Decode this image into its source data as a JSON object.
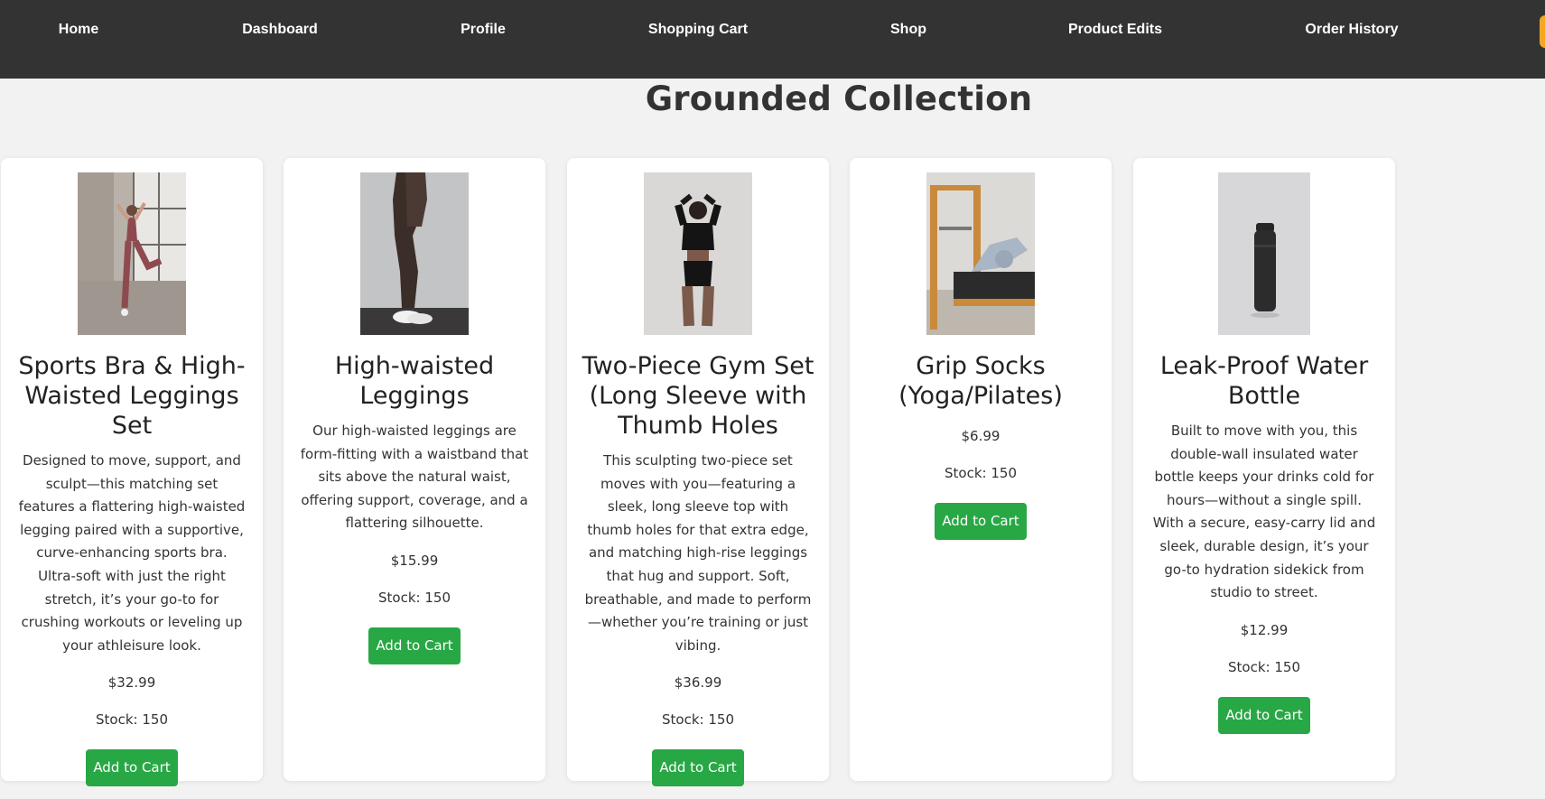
{
  "nav": {
    "items": [
      {
        "label": "Home"
      },
      {
        "label": "Dashboard"
      },
      {
        "label": "Profile"
      },
      {
        "label": "Shopping Cart"
      },
      {
        "label": "Shop"
      },
      {
        "label": "Product Edits"
      },
      {
        "label": "Order History"
      }
    ]
  },
  "page": {
    "title": "Grounded Collection"
  },
  "products": [
    {
      "name": "Sports Bra & High-Waisted Leggings Set",
      "description": "Designed to move, support, and sculpt—this matching set features a flattering high-waisted legging paired with a supportive, curve-enhancing sports bra. Ultra-soft with just the right stretch, it’s your go-to for crushing workouts or leveling up your athleisure look.",
      "price": "$32.99",
      "stock": "Stock: 150",
      "button": "Add to Cart"
    },
    {
      "name": "High-waisted Leggings",
      "description": "Our high-waisted leggings are form-fitting with a waistband that sits above the natural waist, offering support, coverage, and a flattering silhouette.",
      "price": "$15.99",
      "stock": "Stock: 150",
      "button": "Add to Cart"
    },
    {
      "name": "Two-Piece Gym Set (Long Sleeve with Thumb Holes",
      "description": "This sculpting two-piece set moves with you—featuring a sleek, long sleeve top with thumb holes for that extra edge, and matching high-rise leggings that hug and support. Soft, breathable, and made to perform—whether you’re training or just vibing.",
      "price": "$36.99",
      "stock": "Stock: 150",
      "button": "Add to Cart"
    },
    {
      "name": "Grip Socks (Yoga/Pilates)",
      "description": "",
      "price": "$6.99",
      "stock": "Stock: 150",
      "button": "Add to Cart"
    },
    {
      "name": "Leak-Proof Water Bottle",
      "description": "Built to move with you, this double-wall insulated water bottle keeps your drinks cold for hours—without a single spill. With a secure, easy-carry lid and sleek, durable design, it’s your go-to hydration sidekick from studio to street.",
      "price": "$12.99",
      "stock": "Stock: 150",
      "button": "Add to Cart"
    }
  ],
  "colors": {
    "navbar": "#333333",
    "background": "#f2f2f2",
    "button": "#28a745",
    "accent": "#f5a623"
  }
}
